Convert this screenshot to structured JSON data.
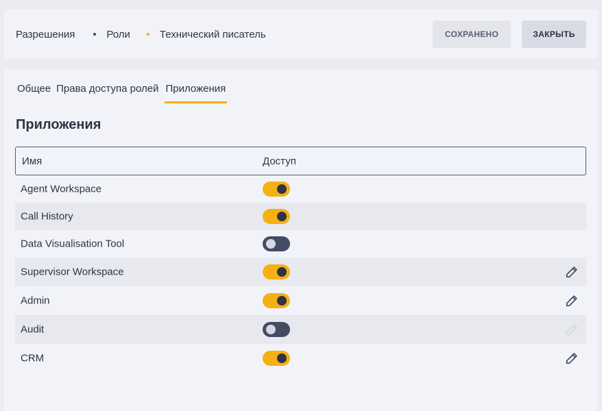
{
  "breadcrumb": [
    "Разрешения",
    "Роли",
    "Технический писатель"
  ],
  "header": {
    "saved_label": "СОХРАНЕНО",
    "close_label": "ЗАКРЫТЬ"
  },
  "tabs": [
    "Общее",
    "Права доступа ролей",
    "Приложения"
  ],
  "active_tab": "Приложения",
  "section_title": "Приложения",
  "table": {
    "columns": [
      "Имя",
      "Доступ"
    ],
    "rows": [
      {
        "name": "Agent Workspace",
        "access": true,
        "edit": "none"
      },
      {
        "name": "Call History",
        "access": true,
        "edit": "none"
      },
      {
        "name": "Data Visualisation Tool",
        "access": false,
        "edit": "none"
      },
      {
        "name": "Supervisor Workspace",
        "access": true,
        "edit": "enabled"
      },
      {
        "name": "Admin",
        "access": true,
        "edit": "enabled"
      },
      {
        "name": "Audit",
        "access": false,
        "edit": "disabled"
      },
      {
        "name": "CRM",
        "access": true,
        "edit": "enabled"
      }
    ]
  },
  "colors": {
    "accent": "#f5b014",
    "toggle_off": "#434b65",
    "text": "#2f3342"
  }
}
